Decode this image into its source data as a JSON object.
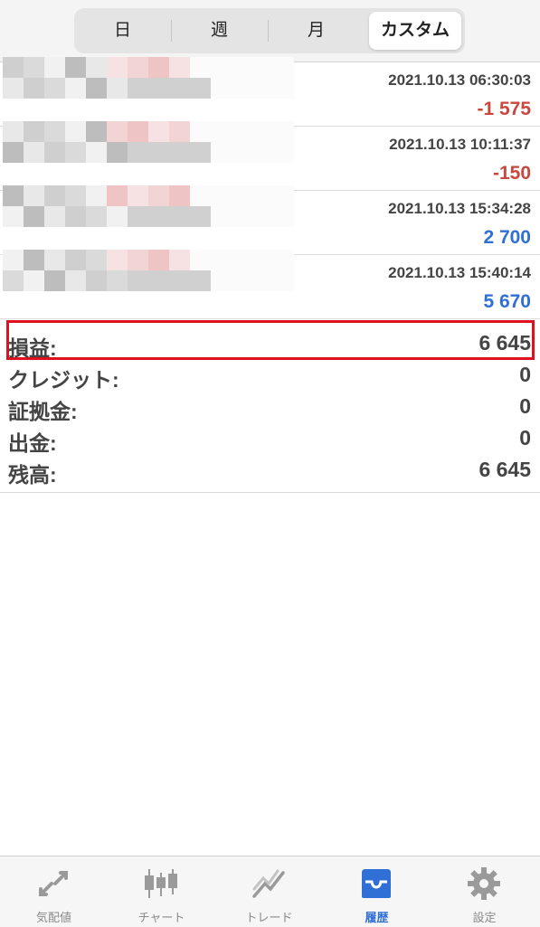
{
  "period_tabs": [
    "日",
    "週",
    "月",
    "カスタム"
  ],
  "selected_period": "カスタム",
  "deals": [
    {
      "time": "2021.10.13 06:30:03",
      "profit": "-1 575",
      "sign": "neg"
    },
    {
      "time": "2021.10.13 10:11:37",
      "profit": "-150",
      "sign": "neg"
    },
    {
      "time": "2021.10.13 15:34:28",
      "profit": "2 700",
      "sign": "pos"
    },
    {
      "time": "2021.10.13 15:40:14",
      "profit": "5 670",
      "sign": "pos"
    }
  ],
  "summary": [
    {
      "label": "損益:",
      "value": "6 645"
    },
    {
      "label": "クレジット:",
      "value": "0"
    },
    {
      "label": "証拠金:",
      "value": "0"
    },
    {
      "label": "出金:",
      "value": "0"
    },
    {
      "label": "残高:",
      "value": "6 645"
    }
  ],
  "tabbar": [
    {
      "label": "気配値",
      "icon": "quotes-icon"
    },
    {
      "label": "チャート",
      "icon": "chart-icon"
    },
    {
      "label": "トレード",
      "icon": "trade-icon"
    },
    {
      "label": "履歴",
      "icon": "history-icon"
    },
    {
      "label": "設定",
      "icon": "settings-icon"
    }
  ],
  "active_tab": "履歴",
  "colors": {
    "negative": "#c9473f",
    "positive": "#2f6fd6",
    "highlight": "#e0101e"
  }
}
